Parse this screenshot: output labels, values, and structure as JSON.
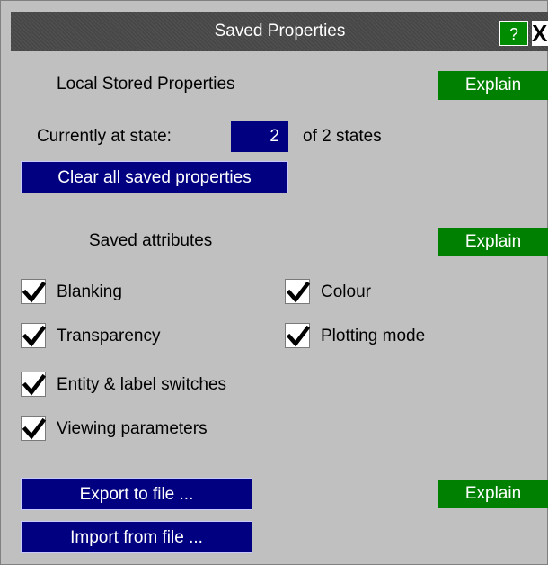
{
  "window": {
    "title": "Saved Properties",
    "help_label": "?",
    "close_label": "X"
  },
  "stored": {
    "heading": "Local Stored Properties",
    "explain_label": "Explain",
    "state_prefix": "Currently at state:",
    "state_value": "2",
    "state_suffix": "of 2 states",
    "clear_label": "Clear all saved properties"
  },
  "attributes": {
    "heading": "Saved attributes",
    "explain_label": "Explain",
    "items": [
      {
        "label": "Blanking",
        "checked": true
      },
      {
        "label": "Colour",
        "checked": true
      },
      {
        "label": "Transparency",
        "checked": true
      },
      {
        "label": "Plotting mode",
        "checked": true
      },
      {
        "label": "Entity & label switches",
        "checked": true
      },
      {
        "label": "Viewing parameters",
        "checked": true
      }
    ]
  },
  "file": {
    "export_label": "Export to file ...",
    "import_label": "Import from file ...",
    "explain_label": "Explain"
  },
  "colors": {
    "panel_bg": "#c0c0c0",
    "title_bg": "#474747",
    "explain_green": "#008000",
    "button_blue": "#000080"
  }
}
